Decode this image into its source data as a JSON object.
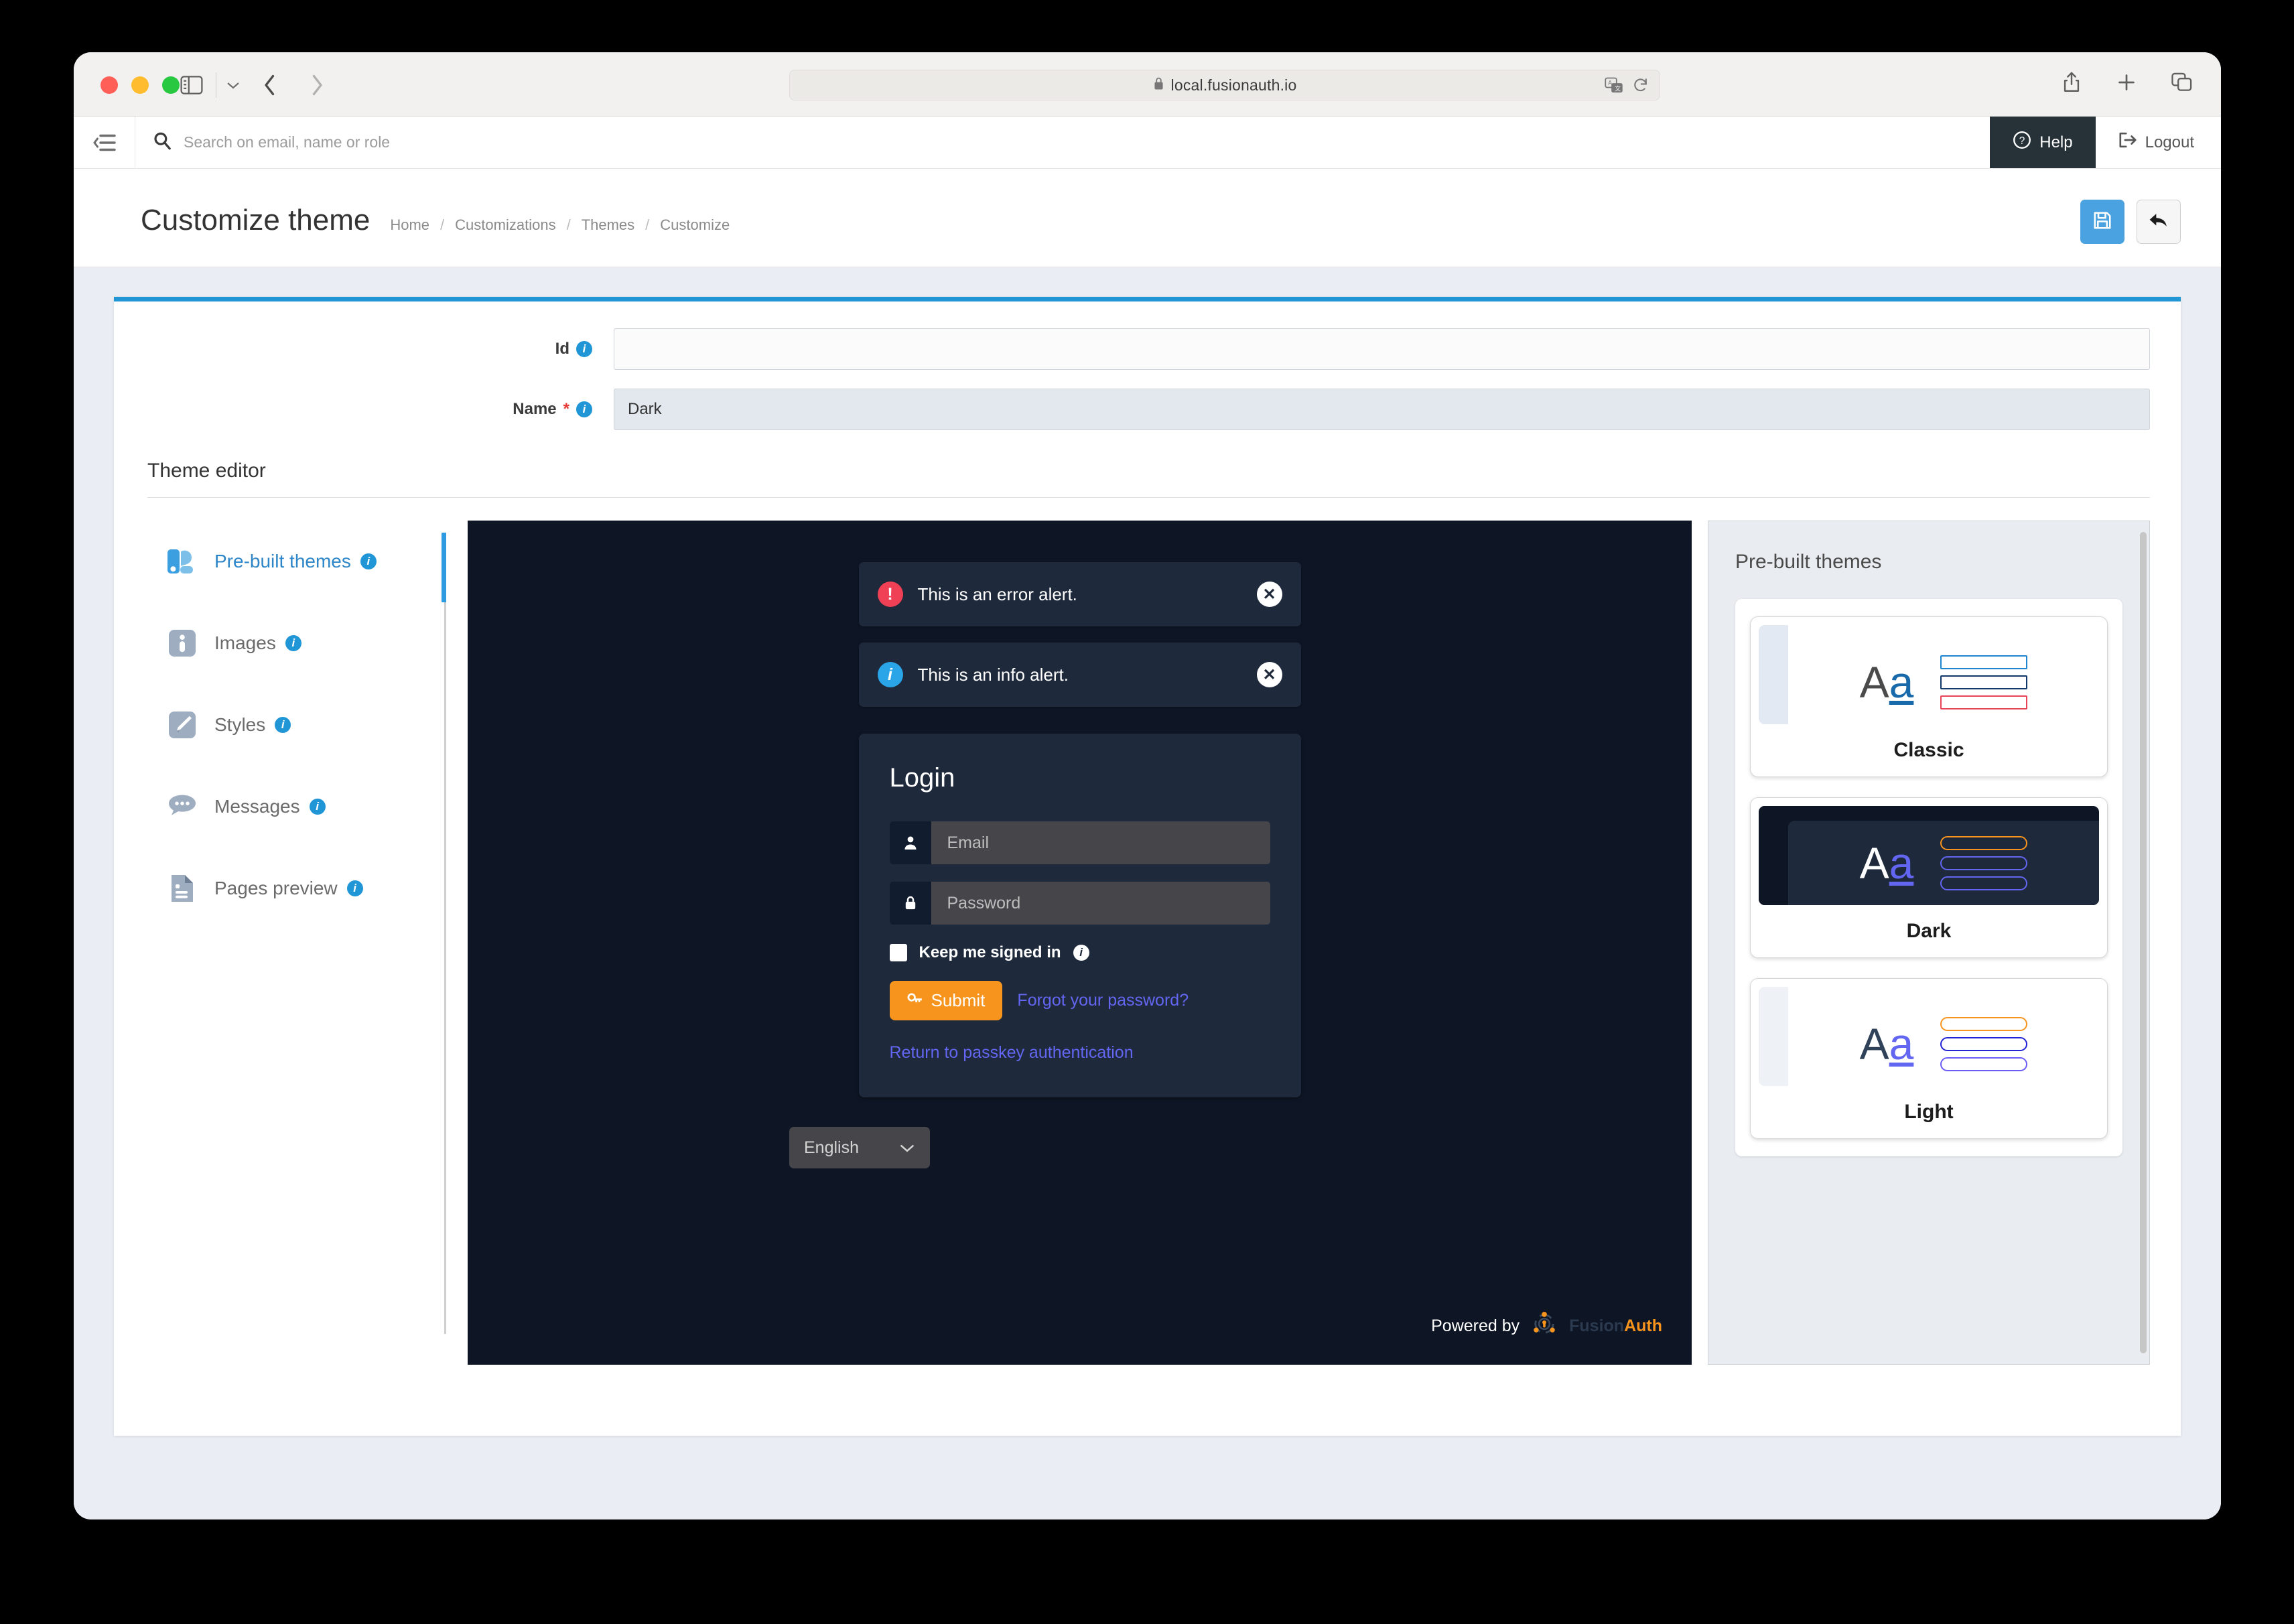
{
  "browser": {
    "url": "local.fusionauth.io",
    "lock_icon": "lock-icon",
    "translate_icon": "translate-icon",
    "reload_icon": "reload-icon",
    "share_icon": "share-icon",
    "new_tab_icon": "plus-icon",
    "tabs_icon": "tab-overview-icon",
    "sidebar_icon": "sidebar-toggle-icon",
    "back_icon": "chevron-left-icon",
    "forward_icon": "chevron-right-icon"
  },
  "topbar": {
    "menu_icon": "collapse-menu-icon",
    "search_placeholder": "Search on email, name or role",
    "search_icon": "search-icon",
    "help_label": "Help",
    "help_icon": "question-circle-icon",
    "logout_label": "Logout",
    "logout_icon": "sign-out-icon"
  },
  "header": {
    "title": "Customize theme",
    "breadcrumb": [
      "Home",
      "Customizations",
      "Themes",
      "Customize"
    ],
    "save_icon": "save-floppy-icon",
    "back_icon": "undo-arrow-icon"
  },
  "form": {
    "id": {
      "label": "Id",
      "value": "",
      "info_icon": "info-icon"
    },
    "name": {
      "label": "Name",
      "required": "*",
      "value": "Dark",
      "info_icon": "info-icon"
    }
  },
  "editor": {
    "section_title": "Theme editor",
    "nav": [
      {
        "label": "Pre-built themes",
        "icon": "prebuilt-themes-icon",
        "active": true
      },
      {
        "label": "Images",
        "icon": "images-icon",
        "active": false
      },
      {
        "label": "Styles",
        "icon": "styles-pencil-icon",
        "active": false
      },
      {
        "label": "Messages",
        "icon": "messages-bubble-icon",
        "active": false
      },
      {
        "label": "Pages preview",
        "icon": "pages-preview-icon",
        "active": false
      }
    ]
  },
  "preview": {
    "alerts": [
      {
        "text": "This is an error alert.",
        "type": "error",
        "icon": "error-circle-icon",
        "close_icon": "close-circle-icon"
      },
      {
        "text": "This is an info alert.",
        "type": "info",
        "icon": "info-circle-icon",
        "close_icon": "close-circle-icon"
      }
    ],
    "login": {
      "title": "Login",
      "email_placeholder": "Email",
      "email_icon": "user-icon",
      "password_placeholder": "Password",
      "password_icon": "lock-icon",
      "keep_signed_label": "Keep me signed in",
      "keep_signed_info_icon": "info-icon",
      "submit_label": "Submit",
      "submit_icon": "key-icon",
      "forgot_label": "Forgot your password?",
      "passkey_label": "Return to passkey authentication"
    },
    "language": {
      "value": "English",
      "chevron_icon": "chevron-down-icon"
    },
    "powered_by": {
      "prefix": "Powered by",
      "brand_first": "Fusion",
      "brand_second": "Auth",
      "logo_icon": "fusionauth-logo-icon"
    }
  },
  "theme_panel": {
    "title": "Pre-built themes",
    "themes": [
      {
        "name": "Classic",
        "thumb_bg": "#ffffff",
        "thumb_sidebar": "#e3e9f2",
        "thumb_header": "#e3e9f2",
        "letter_upper_color": "#4a4a4a",
        "letter_lower_color": "#1769aa",
        "bars": [
          {
            "color": "#2186cf",
            "shape": "square"
          },
          {
            "color": "#13396b",
            "shape": "square"
          },
          {
            "color": "#e8445a",
            "shape": "square"
          }
        ],
        "selected": false
      },
      {
        "name": "Dark",
        "thumb_bg": "#1e293b",
        "thumb_sidebar": "#0e1626",
        "thumb_header": "#0e1626",
        "letter_upper_color": "#ffffff",
        "letter_lower_color": "#6366f1",
        "bars": [
          {
            "color": "#f7941e",
            "shape": "pill"
          },
          {
            "color": "#6366f1",
            "shape": "pill"
          },
          {
            "color": "#6366f1",
            "shape": "pill"
          }
        ],
        "selected": true
      },
      {
        "name": "Light",
        "thumb_bg": "#ffffff",
        "thumb_sidebar": "#eef1f6",
        "thumb_header": "#eef1f6",
        "letter_upper_color": "#30425a",
        "letter_lower_color": "#6366f1",
        "bars": [
          {
            "color": "#f7941e",
            "shape": "pill"
          },
          {
            "color": "#2323d6",
            "shape": "pill"
          },
          {
            "color": "#6b5cf6",
            "shape": "pill"
          }
        ],
        "selected": false
      }
    ]
  },
  "colors": {
    "accent_blue": "#2196d6",
    "orange": "#f7941e",
    "indigo": "#6366f1",
    "error_red": "#ef4056",
    "dark_navy": "#0e1626",
    "slate": "#1e293b"
  }
}
